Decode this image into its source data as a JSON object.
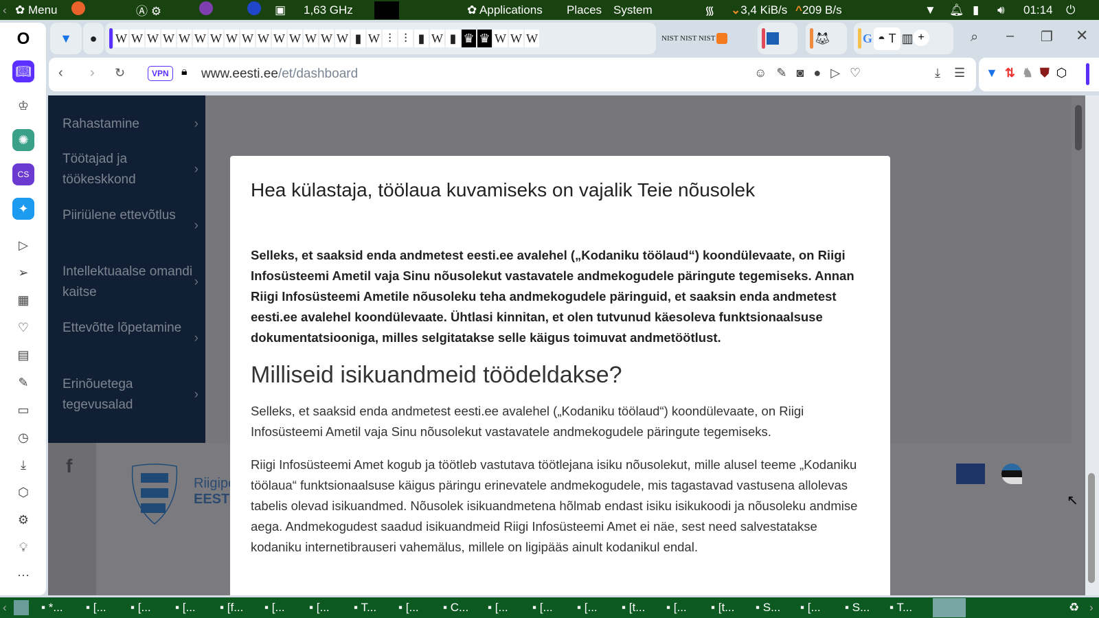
{
  "system_panel": {
    "menu": "Menu",
    "cpu": "1,63 GHz",
    "applications": "Applications",
    "places": "Places",
    "system": "System",
    "net_down": "3,4 KiB/s",
    "net_up": "209 B/s",
    "clock": "01:14"
  },
  "browser": {
    "url_host": "www.eesti.ee",
    "url_path": "/et/dashboard",
    "vpn": "VPN",
    "active_tab": "T"
  },
  "sidebar_nav": [
    {
      "label": "Rahastamine"
    },
    {
      "label": "Töötajad ja töökeskkond"
    },
    {
      "label": "Piiriülene ettevõtlus"
    },
    {
      "label": "Intellektuaalse omandi kaitse"
    },
    {
      "label": "Ettevõtte lõpetamine"
    },
    {
      "label": "Erinõuetega tegevusalad"
    }
  ],
  "footer": {
    "logo_line1": "Riigipo",
    "logo_line2": "EESTI.E"
  },
  "modal": {
    "title": "Hea külastaja, töölaua kuvamiseks on vajalik Teie nõusolek",
    "consent_text": "Selleks, et saaksid enda andmetest eesti.ee avalehel („Kodaniku töölaud“) koondülevaate, on Riigi Infosüsteemi Ametil vaja Sinu nõusolekut vastavatele andmekogudele päringute tegemiseks. Annan Riigi Infosüsteemi Ametile nõusoleku teha andmekogudele päringuid, et saaksin enda andmetest eesti.ee avalehel koondülevaate. Ühtlasi kinnitan, et olen tutvunud käesoleva funktsionaalsuse dokumentatsiooniga, milles selgitatakse selle käigus toimuvat andmetöötlust.",
    "heading2": "Milliseid isikuandmeid töödeldakse?",
    "para1": "Selleks, et saaksid enda andmetest eesti.ee avalehel („Kodaniku töölaud“) koondülevaate, on Riigi Infosüsteemi Ametil vaja Sinu nõusolekut vastavatele andmekogudele päringute tegemiseks.",
    "para2": "Riigi Infosüsteemi Amet kogub ja töötleb vastutava töötlejana isiku nõusolekut, mille alusel teeme „Kodaniku töölaua“ funktsionaalsuse käigus päringu erinevatele andmekogudele, mis tagastavad vastusena allolevas tabelis olevad isikuandmed. Nõusolek isikuandmetena hõlmab endast isiku isikukoodi ja nõusoleku andmise aega. Andmekogudest saadud isikuandmeid Riigi Infosüsteemi Amet ei näe, sest need salvestatakse kodaniku internetibrauseri vahemälus, millele on ligipääs ainult kodanikul endal."
  },
  "taskbar": [
    "*...",
    "[...",
    "[...",
    "[...",
    "[f...",
    "[...",
    "[...",
    "T...",
    "[...",
    "C...",
    "[...",
    "[...",
    "[...",
    "[t...",
    "[...",
    "[t...",
    "S...",
    "[...",
    "S...",
    "T..."
  ]
}
